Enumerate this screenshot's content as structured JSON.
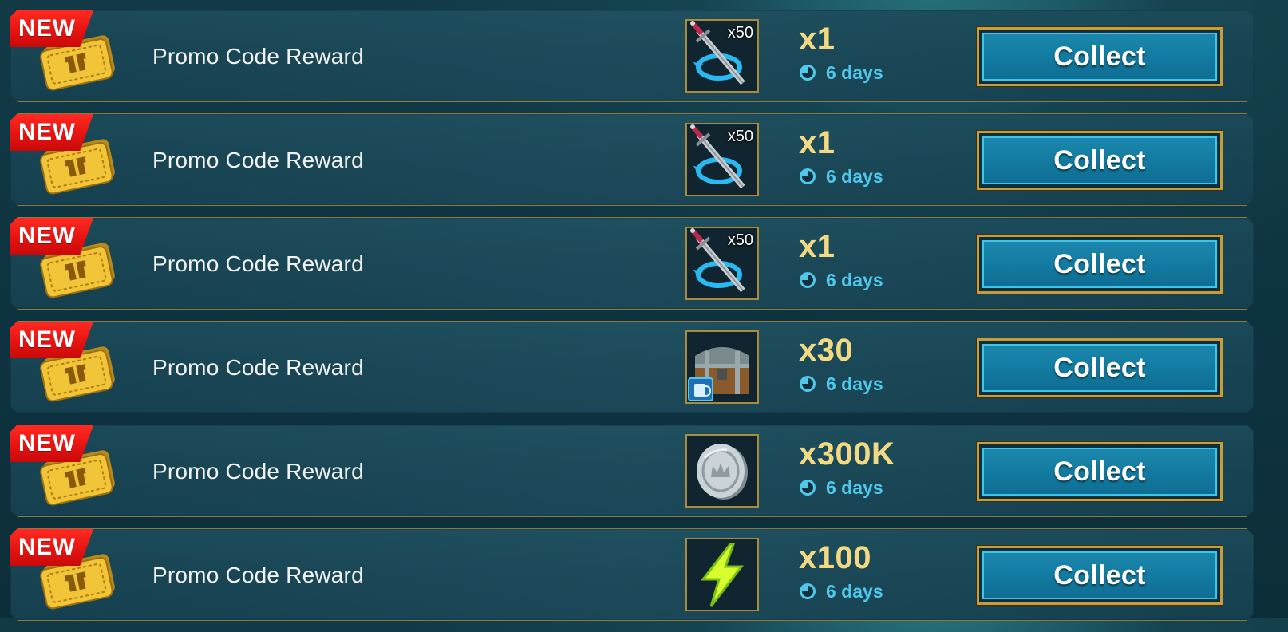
{
  "colors": {
    "accent_gold": "#f3d982",
    "duration_blue": "#4fc8ec",
    "badge_red": "#e3120f",
    "button_blue": "#137ba1",
    "frame_gold": "#c79d3a"
  },
  "rewards": [
    {
      "badge": "NEW",
      "title": "Promo Code Reward",
      "icon": "sword-teleport-icon",
      "icon_count": "x50",
      "quantity": "x1",
      "duration": "6 days",
      "button": "Collect"
    },
    {
      "badge": "NEW",
      "title": "Promo Code Reward",
      "icon": "sword-teleport-icon",
      "icon_count": "x50",
      "quantity": "x1",
      "duration": "6 days",
      "button": "Collect"
    },
    {
      "badge": "NEW",
      "title": "Promo Code Reward",
      "icon": "sword-teleport-icon",
      "icon_count": "x50",
      "quantity": "x1",
      "duration": "6 days",
      "button": "Collect"
    },
    {
      "badge": "NEW",
      "title": "Promo Code Reward",
      "icon": "treasure-chest-icon",
      "icon_count": "",
      "quantity": "x30",
      "duration": "6 days",
      "button": "Collect"
    },
    {
      "badge": "NEW",
      "title": "Promo Code Reward",
      "icon": "silver-coin-icon",
      "icon_count": "",
      "quantity": "x300K",
      "duration": "6 days",
      "button": "Collect"
    },
    {
      "badge": "NEW",
      "title": "Promo Code Reward",
      "icon": "energy-bolt-icon",
      "icon_count": "",
      "quantity": "x100",
      "duration": "6 days",
      "button": "Collect"
    }
  ]
}
